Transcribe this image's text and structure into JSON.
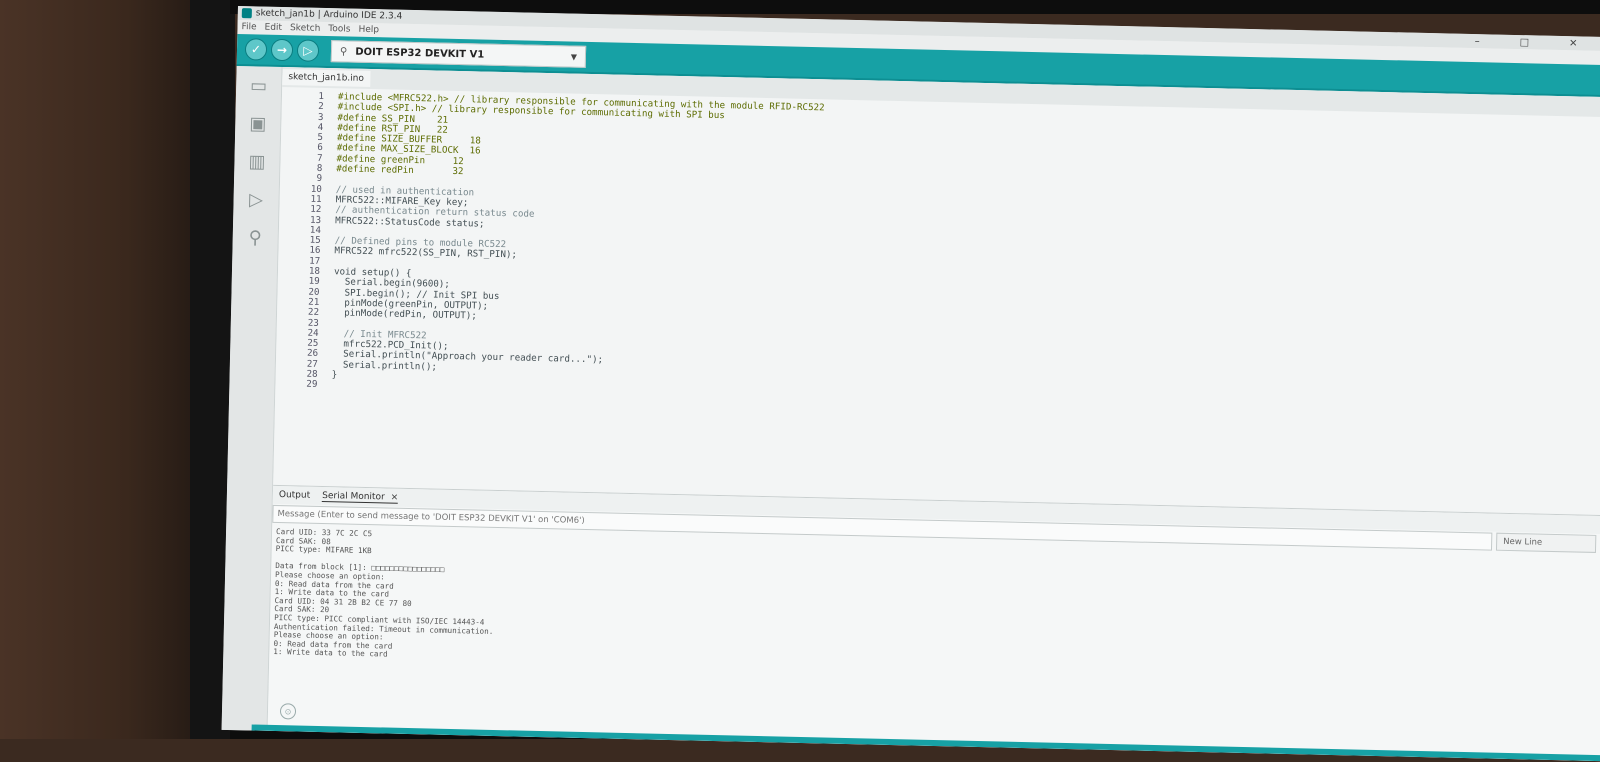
{
  "window": {
    "title": "sketch_jan1b | Arduino IDE 2.3.4",
    "controls": [
      "–",
      "□",
      "✕"
    ]
  },
  "menu": [
    "File",
    "Edit",
    "Sketch",
    "Tools",
    "Help"
  ],
  "toolbar": {
    "verify_icon": "check-icon",
    "upload_icon": "arrow-right-icon",
    "debug_icon": "debug-icon",
    "board": "DOIT ESP32 DEVKIT V1"
  },
  "sidebar": [
    "folder-icon",
    "board-icon",
    "library-icon",
    "debug-icon",
    "search-icon"
  ],
  "editor": {
    "file_tab": "sketch_jan1b.ino",
    "lines": [
      {
        "n": "1",
        "text": "#include <MFRC522.h> // library responsible for communicating with the module RFID-RC522"
      },
      {
        "n": "2",
        "text": "#include <SPI.h> // library responsible for communicating with SPI bus"
      },
      {
        "n": "3",
        "text": "#define SS_PIN    21"
      },
      {
        "n": "4",
        "text": "#define RST_PIN   22"
      },
      {
        "n": "5",
        "text": "#define SIZE_BUFFER     18"
      },
      {
        "n": "6",
        "text": "#define MAX_SIZE_BLOCK  16"
      },
      {
        "n": "7",
        "text": "#define greenPin     12"
      },
      {
        "n": "8",
        "text": "#define redPin       32"
      },
      {
        "n": "9",
        "text": ""
      },
      {
        "n": "10",
        "text": "// used in authentication"
      },
      {
        "n": "11",
        "text": "MFRC522::MIFARE_Key key;"
      },
      {
        "n": "12",
        "text": "// authentication return status code"
      },
      {
        "n": "13",
        "text": "MFRC522::StatusCode status;"
      },
      {
        "n": "14",
        "text": ""
      },
      {
        "n": "15",
        "text": "// Defined pins to module RC522"
      },
      {
        "n": "16",
        "text": "MFRC522 mfrc522(SS_PIN, RST_PIN);"
      },
      {
        "n": "17",
        "text": ""
      },
      {
        "n": "18",
        "text": "void setup() {"
      },
      {
        "n": "19",
        "text": "  Serial.begin(9600);"
      },
      {
        "n": "20",
        "text": "  SPI.begin(); // Init SPI bus"
      },
      {
        "n": "21",
        "text": "  pinMode(greenPin, OUTPUT);"
      },
      {
        "n": "22",
        "text": "  pinMode(redPin, OUTPUT);"
      },
      {
        "n": "23",
        "text": ""
      },
      {
        "n": "24",
        "text": "  // Init MFRC522"
      },
      {
        "n": "25",
        "text": "  mfrc522.PCD_Init();"
      },
      {
        "n": "26",
        "text": "  Serial.println(\"Approach your reader card...\");"
      },
      {
        "n": "27",
        "text": "  Serial.println();"
      },
      {
        "n": "28",
        "text": "}"
      },
      {
        "n": "29",
        "text": ""
      }
    ]
  },
  "output": {
    "tab_output": "Output",
    "tab_serial": "Serial Monitor",
    "close": "×",
    "message_placeholder": "Message (Enter to send message to 'DOIT ESP32 DEVKIT V1' on 'COM6')",
    "line_ending": "New Line",
    "serial_lines": [
      "Card UID: 33 7C 2C C5",
      "Card SAK: 08",
      "PICC type: MIFARE 1KB",
      "",
      "Data from block [1]: □□□□□□□□□□□□□□□□",
      "Please choose an option:",
      "0: Read data from the card",
      "1: Write data to the card",
      "Card UID: 04 31 2B B2 CE 77 80",
      "Card SAK: 20",
      "PICC type: PICC compliant with ISO/IEC 14443-4",
      "Authentication failed: Timeout in communication.",
      "Please choose an option:",
      "0: Read data from the card",
      "1: Write data to the card"
    ]
  }
}
